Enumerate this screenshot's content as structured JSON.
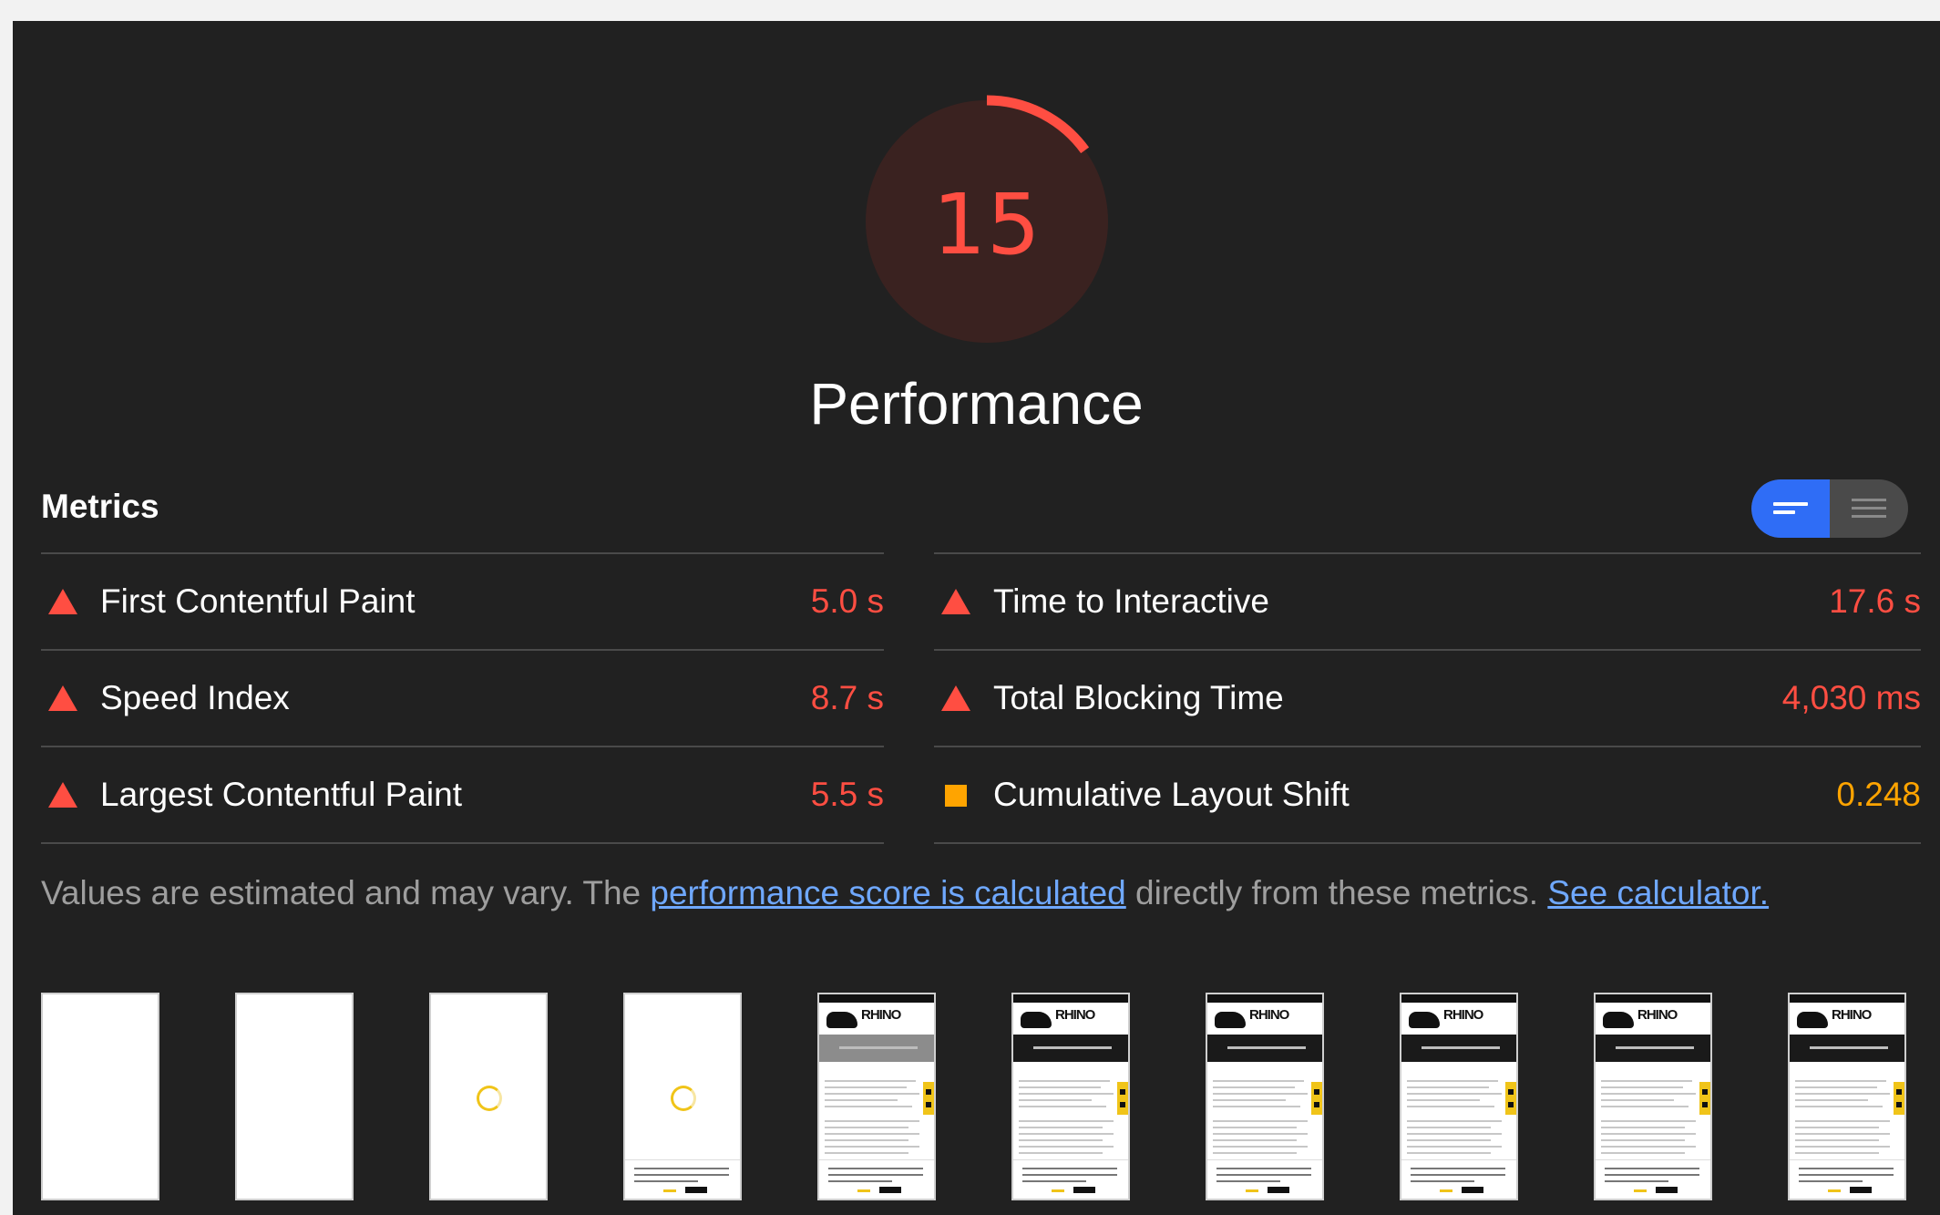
{
  "gauge": {
    "score": "15",
    "score_fraction": 0.15,
    "color": "#ff4e42",
    "title": "Performance"
  },
  "metrics": {
    "heading": "Metrics",
    "toggle": {
      "active_icon": "lines-icon",
      "inactive_icon": "list-icon",
      "active_color": "#2f6df6"
    },
    "left": [
      {
        "label": "First Contentful Paint",
        "value": "5.0 s",
        "status": "fail"
      },
      {
        "label": "Speed Index",
        "value": "8.7 s",
        "status": "fail"
      },
      {
        "label": "Largest Contentful Paint",
        "value": "5.5 s",
        "status": "fail"
      }
    ],
    "right": [
      {
        "label": "Time to Interactive",
        "value": "17.6 s",
        "status": "fail"
      },
      {
        "label": "Total Blocking Time",
        "value": "4,030 ms",
        "status": "fail"
      },
      {
        "label": "Cumulative Layout Shift",
        "value": "0.248",
        "status": "average"
      }
    ],
    "status_colors": {
      "fail": "#ff4e42",
      "average": "#ffa400"
    }
  },
  "note": {
    "prefix": "Values are estimated and may vary. The ",
    "link1": "performance score is calculated",
    "middle": " directly from these metrics. ",
    "link2": "See calculator."
  },
  "filmstrip": {
    "frames": [
      "blank",
      "blank",
      "spinner",
      "spinner-cookie",
      "loaded-grey",
      "loaded",
      "loaded",
      "loaded",
      "loaded",
      "loaded"
    ],
    "logo_text": "RHINO"
  }
}
